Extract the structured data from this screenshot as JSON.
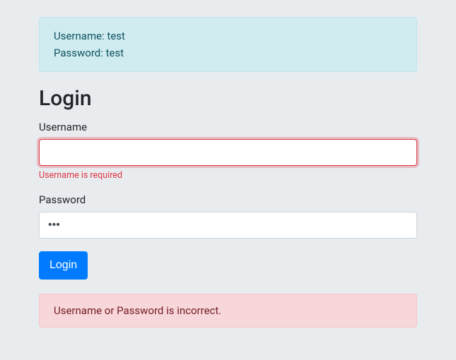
{
  "hint": {
    "line1": "Username: test",
    "line2": "Password: test"
  },
  "heading": "Login",
  "form": {
    "username": {
      "label": "Username",
      "value": "",
      "error": "Username is required"
    },
    "password": {
      "label": "Password",
      "value": "•••"
    },
    "submit_label": "Login"
  },
  "error_message": "Username or Password is incorrect."
}
